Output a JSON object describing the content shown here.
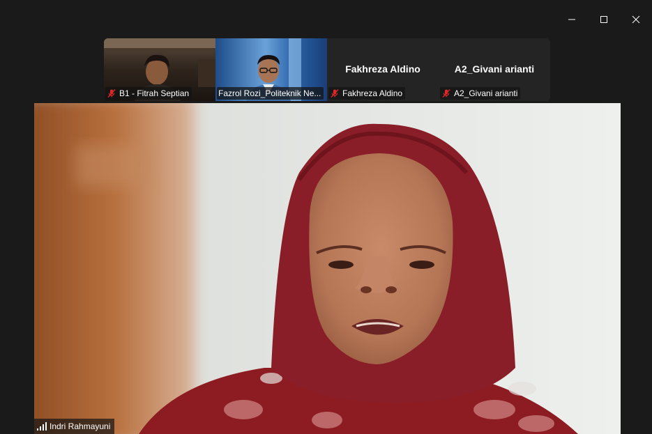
{
  "window": {
    "controls": {
      "minimize_icon": "minimize-icon",
      "maximize_icon": "maximize-icon",
      "close_icon": "close-icon"
    }
  },
  "gallery": {
    "participants": [
      {
        "display_name": "",
        "label": "B1 - Fitrah Septian",
        "muted": true,
        "video_on": true
      },
      {
        "display_name": "",
        "label": "Fazrol Rozi_Politeknik Ne...",
        "muted": false,
        "video_on": true
      },
      {
        "display_name": "Fakhreza Aldino",
        "label": "Fakhreza Aldino",
        "muted": true,
        "video_on": false
      },
      {
        "display_name": "A2_Givani arianti",
        "label": "A2_Givani arianti",
        "muted": true,
        "video_on": false
      }
    ]
  },
  "active_speaker": {
    "label": "Indri Rahmayuni",
    "connection_icon": "signal-bars-icon"
  },
  "colors": {
    "background": "#1a1a1a",
    "tile_background": "#242424",
    "muted_icon": "#e02828",
    "text": "#ffffff"
  }
}
